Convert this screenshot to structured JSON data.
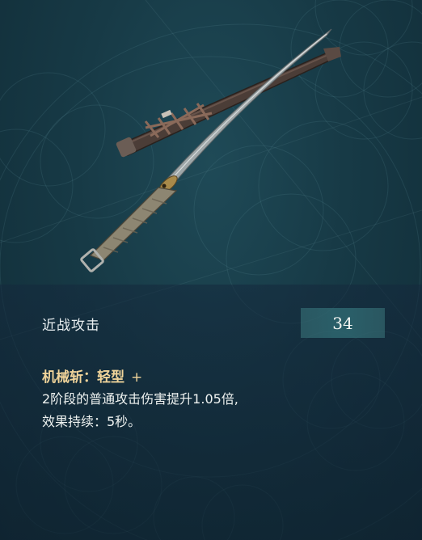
{
  "stat": {
    "label": "近战攻击",
    "value": "34"
  },
  "skill": {
    "title": "机械斩：轻型",
    "plus": "+",
    "desc_line1": "2阶段的普通攻击伤害提升1.05倍,",
    "desc_line2": "效果持续：5秒。"
  },
  "weapon": {
    "icon": "katana-icon"
  },
  "colors": {
    "background": "#173a46",
    "skill_title": "#f0d49a",
    "stat_box": "#3c787d",
    "text": "#eef2f0"
  }
}
